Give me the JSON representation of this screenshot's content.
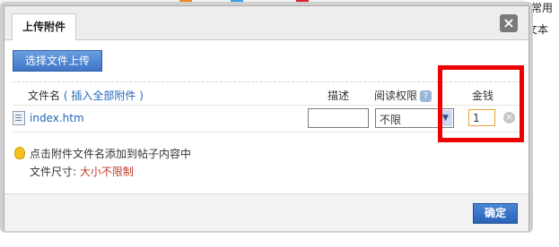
{
  "background": {
    "right_text_top": "常用",
    "right_text_mid": "文本"
  },
  "dialog": {
    "tab_label": "上传附件",
    "close_glyph": "×",
    "upload_button": "选择文件上传",
    "columns": {
      "filename": "文件名",
      "insert_all_open": "(",
      "insert_all": "插入全部附件",
      "insert_all_close": ")",
      "description": "描述",
      "permission": "阅读权限",
      "money": "金钱"
    },
    "file_row": {
      "name": "index.htm",
      "description_value": "",
      "permission_value": "不限",
      "money_value": "1"
    },
    "tip": "点击附件文件名添加到帖子内容中",
    "size_label": "文件尺寸:",
    "size_value": "大小不限制",
    "ok_button": "确定"
  },
  "colors": {
    "accent_blue": "#2366b8",
    "highlight_red": "#ee0000",
    "limit_red": "#c0392b"
  }
}
